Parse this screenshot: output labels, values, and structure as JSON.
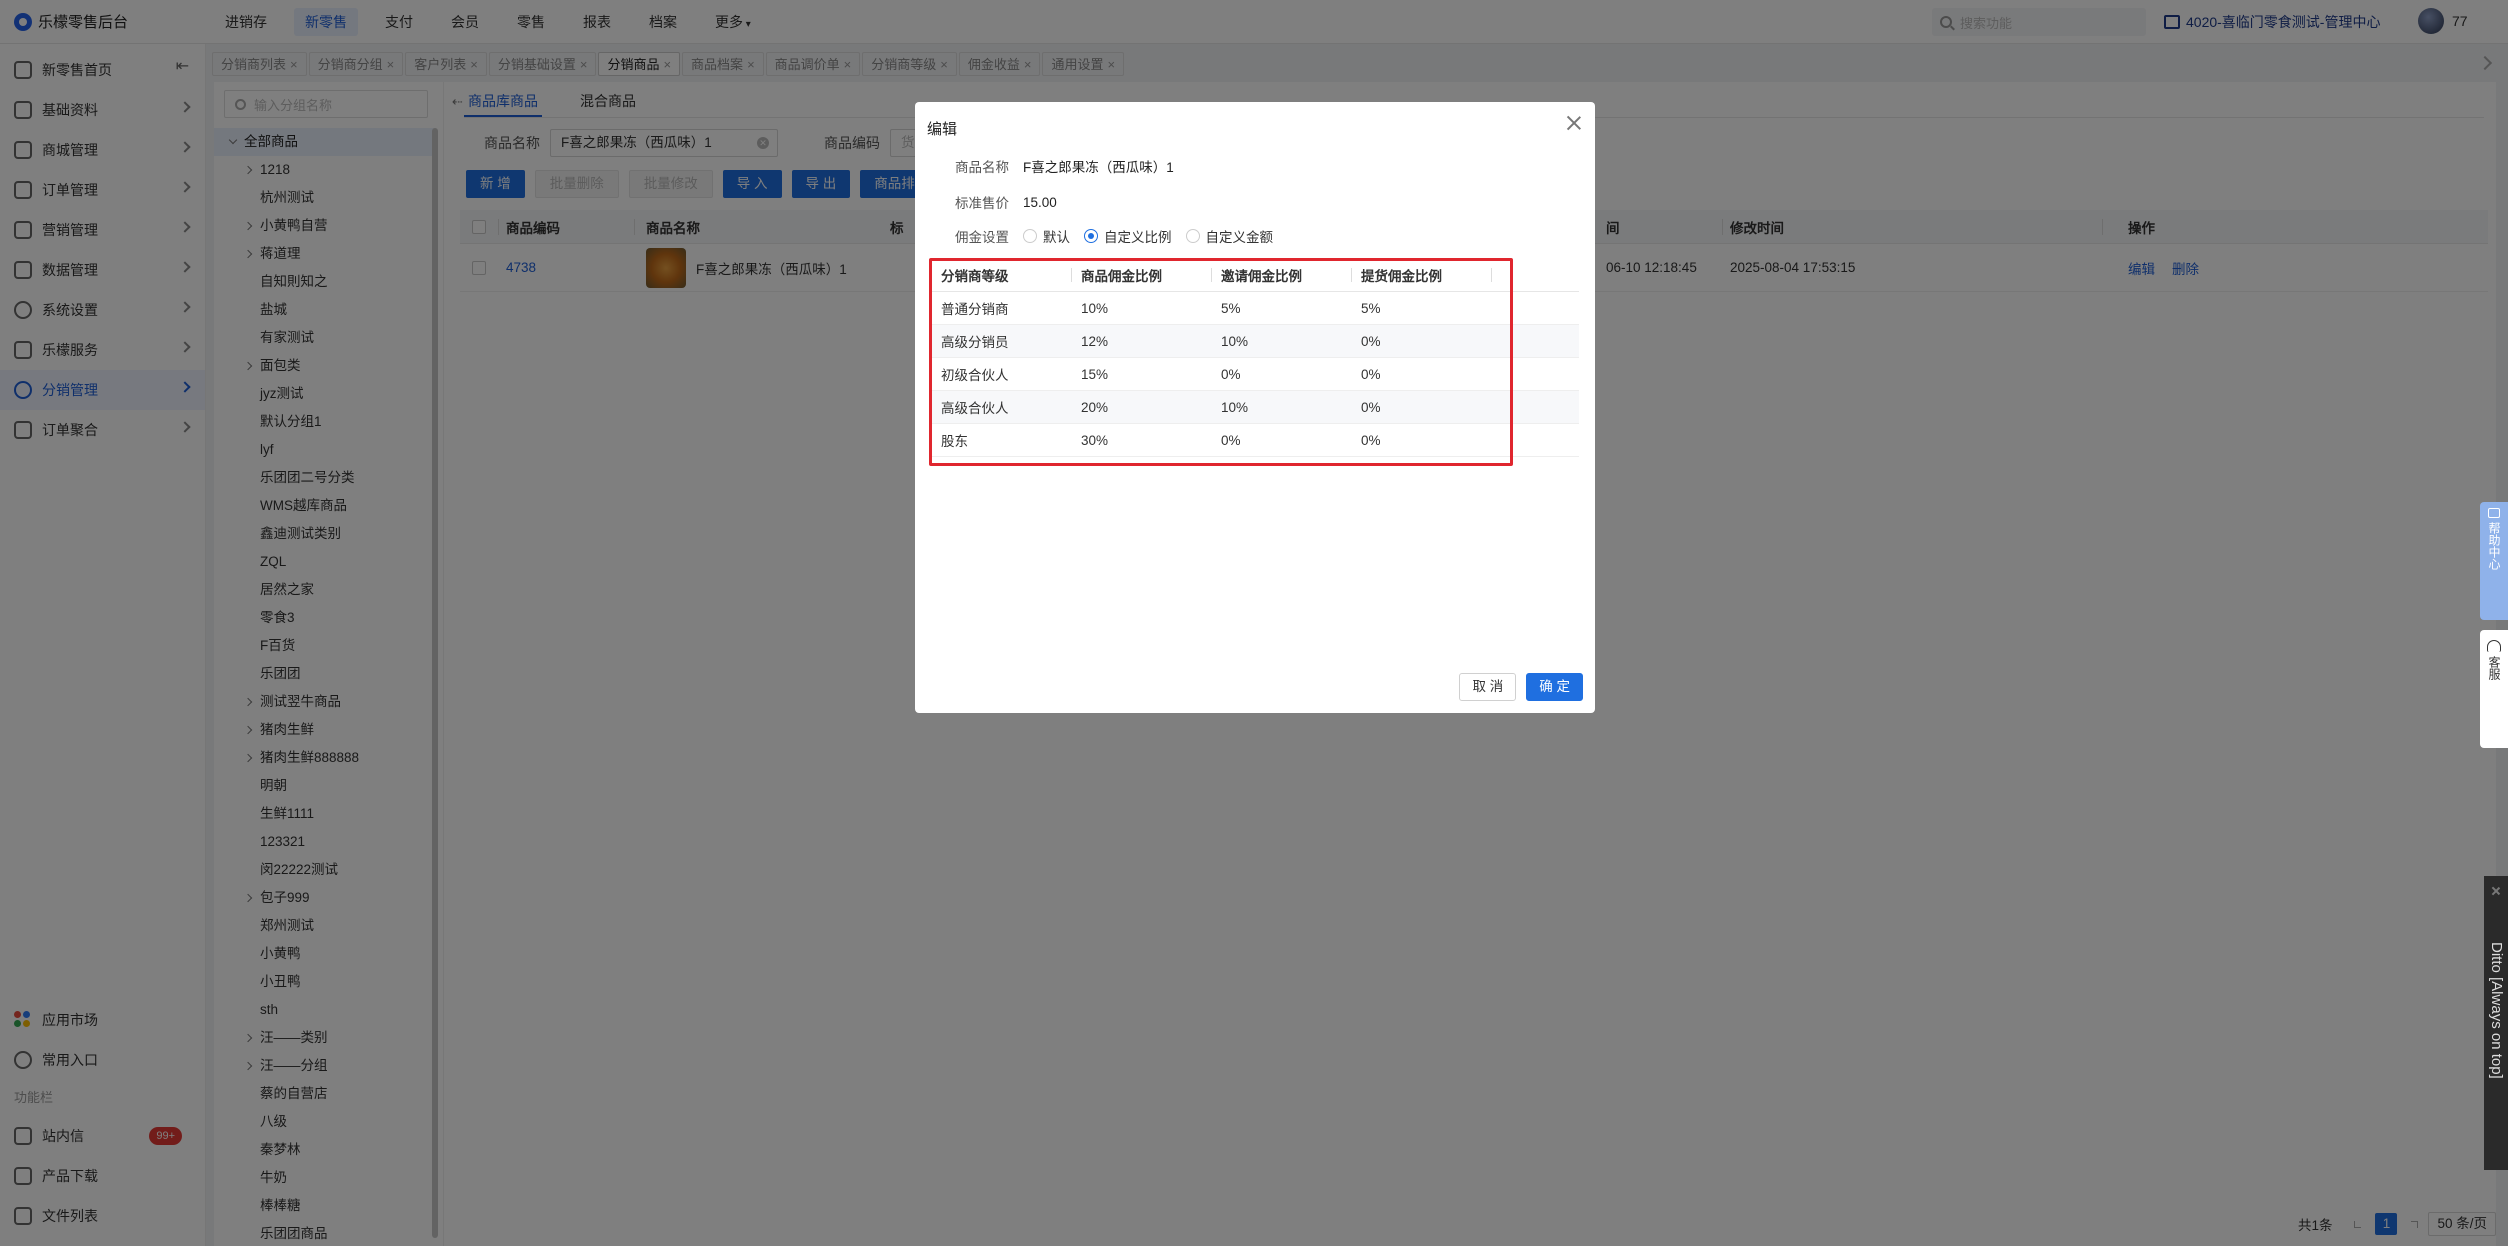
{
  "app": {
    "title": "乐檬零售后台"
  },
  "topnav": [
    "进销存",
    "新零售",
    "支付",
    "会员",
    "零售",
    "报表",
    "档案",
    "更多"
  ],
  "topnav_active": 1,
  "header": {
    "search_placeholder": "搜索功能",
    "shop_name": "4020-喜临门零食测试-管理中心",
    "user_name": "77"
  },
  "sidebar": {
    "items": [
      {
        "label": "新零售首页",
        "icon": "home-icon"
      },
      {
        "label": "基础资料",
        "icon": "grid-icon"
      },
      {
        "label": "商城管理",
        "icon": "shop-icon"
      },
      {
        "label": "订单管理",
        "icon": "order-icon"
      },
      {
        "label": "营销管理",
        "icon": "marketing-icon"
      },
      {
        "label": "数据管理",
        "icon": "data-icon"
      },
      {
        "label": "系统设置",
        "icon": "settings-icon"
      },
      {
        "label": "乐檬服务",
        "icon": "service-icon"
      },
      {
        "label": "分销管理",
        "icon": "distribution-icon"
      },
      {
        "label": "订单聚合",
        "icon": "aggregate-icon"
      }
    ],
    "active_index": 8,
    "bottom": {
      "app_market": "应用市场",
      "common_entry": "常用入口",
      "section_label": "功能栏",
      "messages": "站内信",
      "messages_badge": "99+",
      "downloads": "产品下载",
      "file_list": "文件列表"
    }
  },
  "tabs": [
    {
      "label": "分销商列表",
      "active": false
    },
    {
      "label": "分销商分组",
      "active": false
    },
    {
      "label": "客户列表",
      "active": false
    },
    {
      "label": "分销基础设置",
      "active": false
    },
    {
      "label": "分销商品",
      "active": true
    },
    {
      "label": "商品档案",
      "active": false
    },
    {
      "label": "商品调价单",
      "active": false
    },
    {
      "label": "分销商等级",
      "active": false
    },
    {
      "label": "佣金收益",
      "active": false
    },
    {
      "label": "通用设置",
      "active": false
    }
  ],
  "tree": {
    "search_placeholder": "输入分组名称",
    "root": "全部商品",
    "nodes": [
      {
        "label": "1218",
        "expandable": true
      },
      {
        "label": "杭州测试",
        "expandable": false
      },
      {
        "label": "小黄鸭自营",
        "expandable": true
      },
      {
        "label": "蒋道理",
        "expandable": true
      },
      {
        "label": "自知則知之",
        "expandable": false
      },
      {
        "label": "盐城",
        "expandable": false
      },
      {
        "label": "有家测试",
        "expandable": false
      },
      {
        "label": "面包类",
        "expandable": true
      },
      {
        "label": "jyz测试",
        "expandable": false
      },
      {
        "label": "默认分组1",
        "expandable": false
      },
      {
        "label": "lyf",
        "expandable": false
      },
      {
        "label": "乐团团二号分类",
        "expandable": false
      },
      {
        "label": "WMS越库商品",
        "expandable": false
      },
      {
        "label": "鑫迪测试类别",
        "expandable": false
      },
      {
        "label": "ZQL",
        "expandable": false
      },
      {
        "label": "居然之家",
        "expandable": false
      },
      {
        "label": "零食3",
        "expandable": false
      },
      {
        "label": "F百货",
        "expandable": false
      },
      {
        "label": "乐团团",
        "expandable": false
      },
      {
        "label": "测试翌牛商品",
        "expandable": true
      },
      {
        "label": "猪肉生鲜",
        "expandable": true
      },
      {
        "label": "猪肉生鲜888888",
        "expandable": true
      },
      {
        "label": "明朝",
        "expandable": false
      },
      {
        "label": "生鲜1111",
        "expandable": false
      },
      {
        "label": "123321",
        "expandable": false
      },
      {
        "label": "闵22222测试",
        "expandable": false
      },
      {
        "label": "包子999",
        "expandable": true
      },
      {
        "label": "郑州测试",
        "expandable": false
      },
      {
        "label": "小黄鸭",
        "expandable": false
      },
      {
        "label": "小丑鸭",
        "expandable": false
      },
      {
        "label": "sth",
        "expandable": false
      },
      {
        "label": "汪——类别",
        "expandable": true
      },
      {
        "label": "汪——分组",
        "expandable": true
      },
      {
        "label": "蔡的自营店",
        "expandable": false
      },
      {
        "label": "八级",
        "expandable": false
      },
      {
        "label": "秦梦林",
        "expandable": false
      },
      {
        "label": "牛奶",
        "expandable": false
      },
      {
        "label": "棒棒糖",
        "expandable": false
      },
      {
        "label": "乐团团商品",
        "expandable": false
      }
    ]
  },
  "content": {
    "subtabs": [
      "商品库商品",
      "混合商品"
    ],
    "subtab_active": 0,
    "filters": {
      "name_label": "商品名称",
      "name_value": "F喜之郎果冻（西瓜味）1",
      "code_label": "商品编码",
      "code_placeholder": "货"
    },
    "buttons": {
      "add": "新 增",
      "batch_delete": "批量删除",
      "batch_edit": "批量修改",
      "import": "导 入",
      "export": "导 出",
      "sort": "商品排序"
    },
    "table": {
      "headers": [
        "商品编码",
        "商品名称",
        "标",
        "间",
        "修改时间",
        "操作"
      ],
      "rows": [
        {
          "code": "4738",
          "name": "F喜之郎果冻（西瓜味）1",
          "created": "06-10 12:18:45",
          "modified": "2025-08-04 17:53:15",
          "edit": "编辑",
          "delete": "删除"
        }
      ]
    },
    "pager": {
      "total": "共1条",
      "page": "1",
      "size": "50 条/页"
    }
  },
  "modal": {
    "title": "编辑",
    "name_label": "商品名称",
    "name_value": "F喜之郎果冻（西瓜味）1",
    "price_label": "标准售价",
    "price_value": "15.00",
    "commission_label": "佣金设置",
    "commission_options": [
      "默认",
      "自定义比例",
      "自定义金额"
    ],
    "commission_selected": 1,
    "table_headers": [
      "分销商等级",
      "商品佣金比例",
      "邀请佣金比例",
      "提货佣金比例"
    ],
    "table_rows": [
      [
        "普通分销商",
        "10%",
        "5%",
        "5%"
      ],
      [
        "高级分销员",
        "12%",
        "10%",
        "0%"
      ],
      [
        "初级合伙人",
        "15%",
        "0%",
        "0%"
      ],
      [
        "高级合伙人",
        "20%",
        "10%",
        "0%"
      ],
      [
        "股东",
        "30%",
        "0%",
        "0%"
      ]
    ],
    "cancel": "取 消",
    "confirm": "确 定"
  },
  "floating": {
    "help": "帮助中心",
    "service": "客服",
    "ditto": "Ditto [Always on top]"
  },
  "colors": {
    "primary": "#1f6fe0",
    "highlight_border": "#e0262e",
    "badge": "#e53935"
  }
}
